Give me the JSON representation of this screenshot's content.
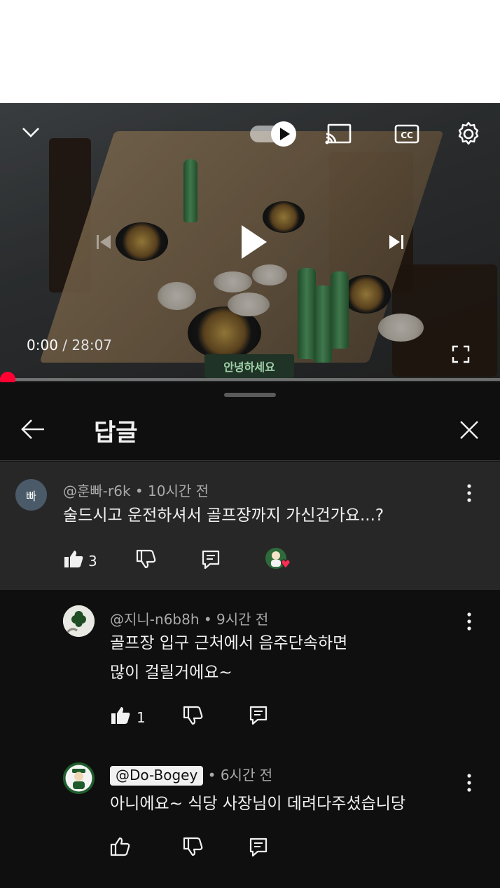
{
  "player": {
    "current_time": "0:00",
    "separator": " / ",
    "duration": "28:07",
    "progress": 0.0,
    "sign_text": "안녕하세요"
  },
  "replies_panel": {
    "title": "답글"
  },
  "parent_comment": {
    "avatar_text": "빠",
    "handle": "@훈빠-r6k",
    "time": "• 10시간 전",
    "text": "술드시고 운전하셔서 골프장까지 가신건가요...?",
    "likes": "3",
    "avatar_color": "#4a5a68"
  },
  "replies": [
    {
      "handle": "@지니-n6b8h",
      "time": "• 9시간 전",
      "lines": [
        "골프장 입구 근처에서 음주단속하면",
        "많이 걸릴거에요~"
      ],
      "likes": "1"
    },
    {
      "handle": "@Do-Bogey",
      "time": "• 6시간 전",
      "lines": [
        "아니에요~ 식당 사장님이 데려다주셨습니당"
      ],
      "likes": ""
    }
  ],
  "colors": {
    "accent": "#ff0033",
    "panel_bg": "#0f0f0f",
    "parent_bg": "#272727"
  }
}
